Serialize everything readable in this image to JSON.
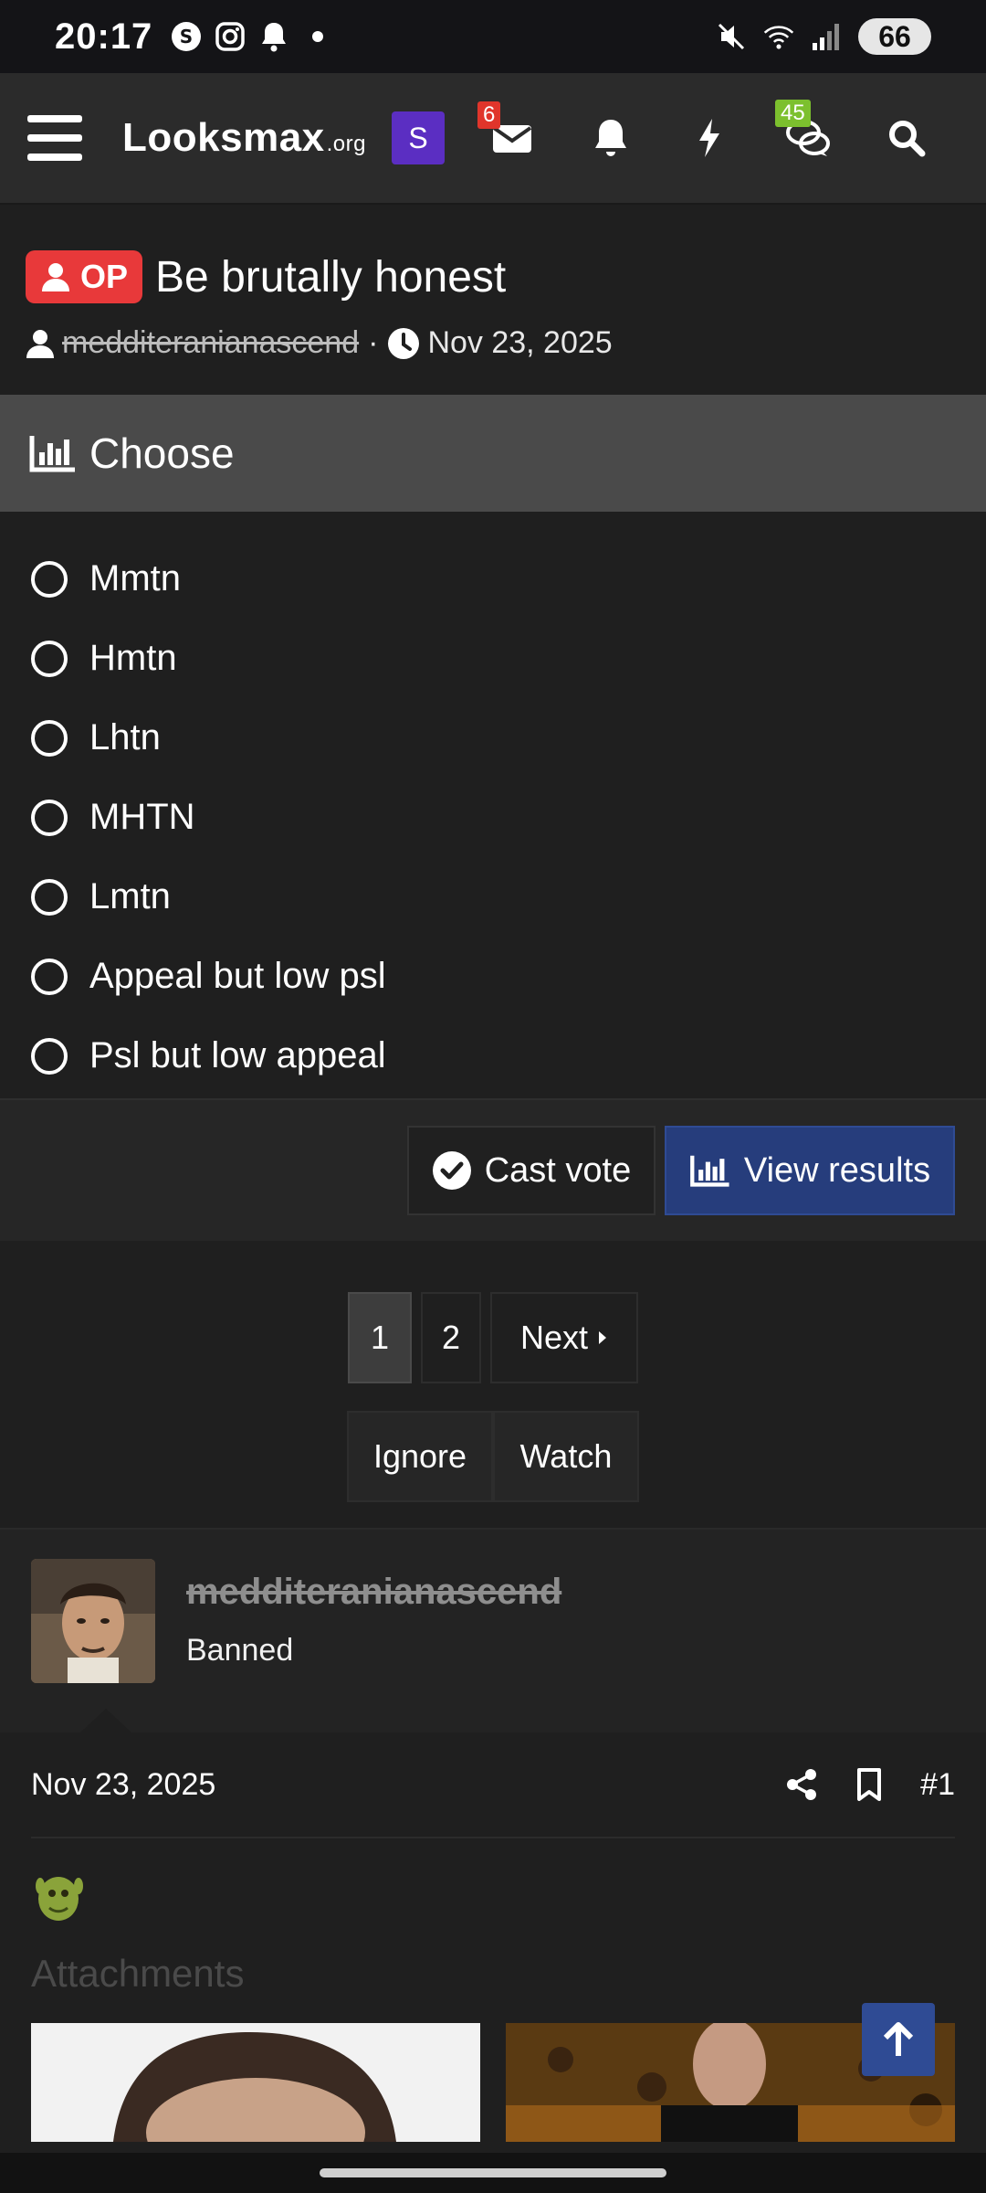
{
  "status_bar": {
    "time": "20:17",
    "battery": "66"
  },
  "header": {
    "logo_main": "Looksmax",
    "logo_suffix": ".org",
    "s_badge": "S",
    "inbox_count": "6",
    "chat_count": "45"
  },
  "thread": {
    "op_label": "OP",
    "title": "Be brutally honest",
    "author": "medditeranianascend",
    "separator": "·",
    "date": "Nov 23, 2025"
  },
  "poll": {
    "title": "Choose",
    "options": [
      "Mmtn",
      "Hmtn",
      "Lhtn",
      "MHTN",
      "Lmtn",
      "Appeal but low psl",
      "Psl but low appeal"
    ],
    "cast_vote_label": "Cast vote",
    "view_results_label": "View results"
  },
  "pagination": {
    "pages": [
      "1",
      "2"
    ],
    "current": "1",
    "next_label": "Next"
  },
  "thread_actions": {
    "ignore_label": "Ignore",
    "watch_label": "Watch"
  },
  "post": {
    "username": "medditeranianascend",
    "role": "Banned",
    "date": "Nov 23, 2025",
    "post_number": "#1",
    "attachments_label": "Attachments"
  },
  "colors": {
    "accent_blue": "#263d7c",
    "op_red": "#e8393a",
    "badge_red": "#e0352b",
    "badge_green": "#7cc02e",
    "s_purple": "#5b2ec2"
  }
}
